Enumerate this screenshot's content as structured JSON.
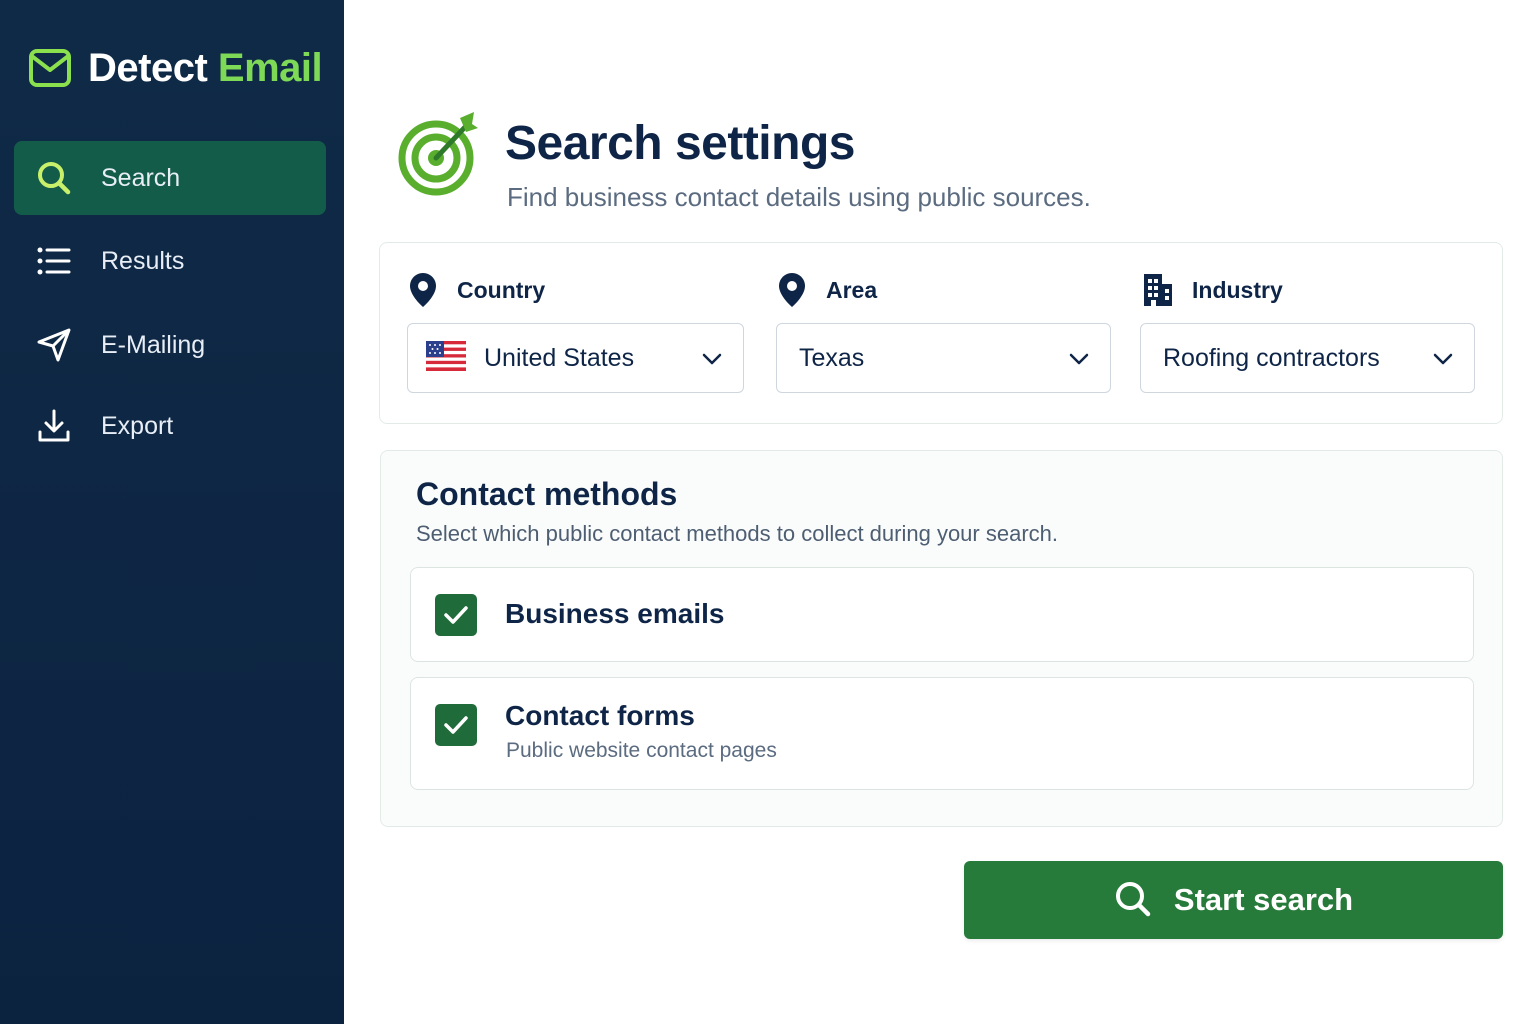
{
  "brand": {
    "name_part1": "Detect",
    "name_part2": "Email",
    "logo_icon": "envelope-icon"
  },
  "colors": {
    "sidebar_bg": "#0f2a47",
    "accent_green": "#7ed957",
    "active_nav": "#145c4a",
    "button_green": "#267a3a",
    "checkbox_green": "#1f6b3a",
    "title_navy": "#0f2547"
  },
  "sidebar": {
    "items": [
      {
        "label": "Search",
        "icon": "search-icon",
        "active": true
      },
      {
        "label": "Results",
        "icon": "list-icon",
        "active": false
      },
      {
        "label": "E-Mailing",
        "icon": "send-icon",
        "active": false
      },
      {
        "label": "Export",
        "icon": "download-icon",
        "active": false
      }
    ]
  },
  "header": {
    "icon": "target-icon",
    "title": "Search settings",
    "subtitle": "Find business contact details using public sources."
  },
  "filters": {
    "country": {
      "label": "Country",
      "icon": "map-pin-icon",
      "value": "United States",
      "flag": "us-flag-icon"
    },
    "area": {
      "label": "Area",
      "icon": "map-pin-icon",
      "value": "Texas"
    },
    "industry": {
      "label": "Industry",
      "icon": "building-icon",
      "value": "Roofing contractors"
    }
  },
  "contact_methods": {
    "title": "Contact methods",
    "subtitle": "Select which public contact methods to collect during your search.",
    "options": [
      {
        "title": "Business emails",
        "description": "",
        "checked": true
      },
      {
        "title": "Contact forms",
        "description": "Public website contact pages",
        "checked": true
      }
    ]
  },
  "actions": {
    "start_label": "Start search",
    "start_icon": "search-icon"
  }
}
